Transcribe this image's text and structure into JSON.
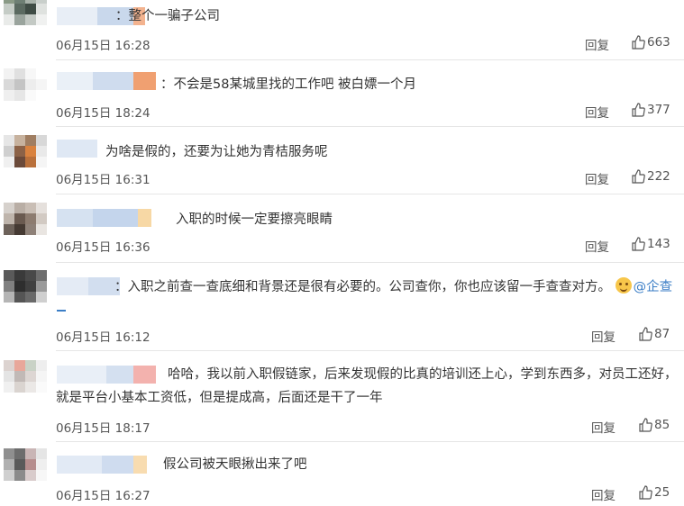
{
  "comments": [
    {
      "text": "整个一骗子公司",
      "time": "06月15日 16:28",
      "reply": "回复",
      "likes": "663"
    },
    {
      "text": "不会是58某城里找的工作吧 被白嫖一个月",
      "time": "06月15日 18:24",
      "reply": "回复",
      "likes": "377"
    },
    {
      "text": "为啥是假的，还要为让她为青桔服务呢",
      "time": "06月15日 16:31",
      "reply": "回复",
      "likes": "222"
    },
    {
      "text": "入职的时候一定要擦亮眼睛",
      "time": "06月15日 16:36",
      "reply": "回复",
      "likes": "143"
    },
    {
      "text": "入职之前查一查底细和背景还是很有必要的。公司查你，你也应该留一手查查对方。",
      "mention": "@企查",
      "time": "06月15日 16:12",
      "reply": "回复",
      "likes": "87"
    },
    {
      "text_line1": "哈哈，我以前入职假链家，后来发现假的比真的培训还上心，学到东西多，对员工还好，",
      "text_line2": "就是平台小基本工资低，但是提成高，后面还是干了一年",
      "time": "06月15日 18:17",
      "reply": "回复",
      "likes": "85"
    },
    {
      "text": "假公司被天眼揪出来了吧",
      "time": "06月15日 16:27",
      "reply": "回复",
      "likes": "25"
    }
  ],
  "colon": "：",
  "icons": {
    "like": "thumbs-up-icon",
    "emoji": "smiling-face-icon"
  },
  "colors": {
    "link": "#3b7ec6",
    "text": "#333333",
    "meta": "#555555",
    "divider": "#e6e6e6"
  }
}
